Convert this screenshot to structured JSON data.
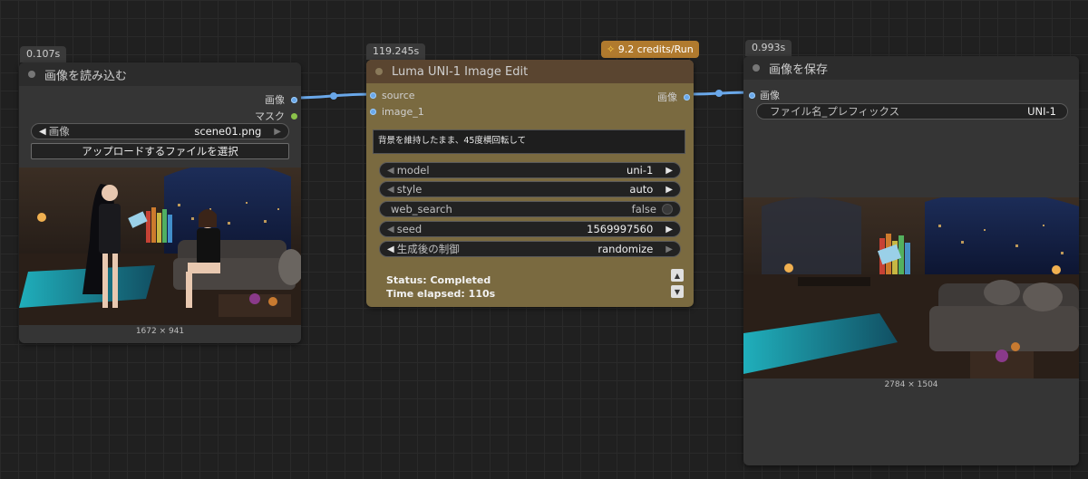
{
  "colors": {
    "canvas_bg": "#202020",
    "node_bg": "#353535",
    "luma_node_bg": "#7a6a40",
    "luma_header_bg": "#5a4530",
    "wire": "#6aa8ea",
    "credits_badge": "#b07a2e"
  },
  "load_node": {
    "time": "0.107s",
    "title": "画像を読み込む",
    "outputs": [
      {
        "label": "画像",
        "icon": "blue-port-icon"
      },
      {
        "label": "マスク",
        "icon": "green-port-icon"
      }
    ],
    "image_widget": {
      "label": "画像",
      "value": "scene01.png"
    },
    "upload_button": "アップロードするファイルを選択",
    "dimensions": "1672 × 941"
  },
  "luma_node": {
    "time": "119.245s",
    "credits": "9.2 credits/Run",
    "credits_icon": "lightning-icon",
    "title": "Luma UNI-1 Image Edit",
    "inputs": [
      {
        "label": "source"
      },
      {
        "label": "image_1"
      }
    ],
    "output": {
      "label": "画像"
    },
    "prompt": "背景を維持したまま、45度横回転して",
    "widgets": {
      "model": {
        "label": "model",
        "value": "uni-1"
      },
      "style": {
        "label": "style",
        "value": "auto"
      },
      "web_search": {
        "label": "web_search",
        "value": "false"
      },
      "seed": {
        "label": "seed",
        "value": "1569997560"
      },
      "control": {
        "label": "生成後の制御",
        "value": "randomize"
      }
    },
    "status": "Status: Completed",
    "elapsed": "Time elapsed: 110s"
  },
  "save_node": {
    "time": "0.993s",
    "title": "画像を保存",
    "input": {
      "label": "画像"
    },
    "prefix_widget": {
      "label": "ファイル名_プレフィックス",
      "value": "UNI-1"
    },
    "dimensions": "2784 × 1504"
  }
}
